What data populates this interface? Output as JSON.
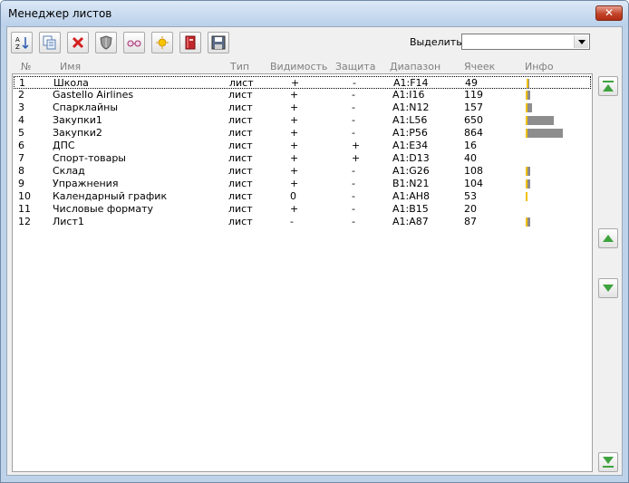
{
  "window": {
    "title": "Менеджер листов"
  },
  "toolbar": {
    "icons": [
      "sort-az-icon",
      "copy-sheets-icon",
      "delete-icon",
      "shield-icon",
      "glasses-icon",
      "new-sheet-icon",
      "book-icon",
      "save-icon"
    ],
    "select_label": "Выделить",
    "select_value": ""
  },
  "columns": {
    "num": "№",
    "name": "Имя",
    "type": "Тип",
    "visibility": "Видимость",
    "protection": "Защита",
    "range": "Диапазон",
    "cells": "Ячеек",
    "info": "Инфо"
  },
  "rows": [
    {
      "num": "1",
      "name": "Школа",
      "type": "лист",
      "visibility": "+",
      "protection": "-",
      "range": "A1:F14",
      "cells": "49",
      "info_level": 0.08
    },
    {
      "num": "2",
      "name": "Gastello Airlines",
      "type": "лист",
      "visibility": "+",
      "protection": "-",
      "range": "A1:I16",
      "cells": "119",
      "info_level": 0.13
    },
    {
      "num": "3",
      "name": "Спарклайны",
      "type": "лист",
      "visibility": "+",
      "protection": "-",
      "range": "A1:N12",
      "cells": "157",
      "info_level": 0.18
    },
    {
      "num": "4",
      "name": "Закупки1",
      "type": "лист",
      "visibility": "+",
      "protection": "-",
      "range": "A1:L56",
      "cells": "650",
      "info_level": 0.75
    },
    {
      "num": "5",
      "name": "Закупки2",
      "type": "лист",
      "visibility": "+",
      "protection": "-",
      "range": "A1:P56",
      "cells": "864",
      "info_level": 1.0
    },
    {
      "num": "6",
      "name": "ДПС",
      "type": "лист",
      "visibility": "+",
      "protection": "+",
      "range": "A1:E34",
      "cells": "16",
      "info_level": 0
    },
    {
      "num": "7",
      "name": "Спорт-товары",
      "type": "лист",
      "visibility": "+",
      "protection": "+",
      "range": "A1:D13",
      "cells": "40",
      "info_level": 0
    },
    {
      "num": "8",
      "name": "Склад",
      "type": "лист",
      "visibility": "+",
      "protection": "-",
      "range": "A1:G26",
      "cells": "108",
      "info_level": 0.13
    },
    {
      "num": "9",
      "name": "Упражнения",
      "type": "лист",
      "visibility": "+",
      "protection": "-",
      "range": "B1:N21",
      "cells": "104",
      "info_level": 0.13
    },
    {
      "num": "10",
      "name": "Календарный график",
      "type": "лист",
      "visibility": "0",
      "protection": "-",
      "range": "A1:AH8",
      "cells": "53",
      "info_level": 0.06
    },
    {
      "num": "11",
      "name": "Числовые формату",
      "type": "лист",
      "visibility": "+",
      "protection": "-",
      "range": "A1:B15",
      "cells": "20",
      "info_level": 0
    },
    {
      "num": "12",
      "name": "Лист1",
      "type": "лист",
      "visibility": "-",
      "protection": "-",
      "range": "A1:A87",
      "cells": "87",
      "info_level": 0.12
    }
  ],
  "selected_row": 0,
  "nav": [
    "move-top-icon",
    "move-up-icon",
    "move-down-icon",
    "move-bottom-icon"
  ],
  "colors": {
    "nav_green": "#3fa33f",
    "bar_gray": "#8d8d8d",
    "bar_yellow": "#f0c000"
  }
}
